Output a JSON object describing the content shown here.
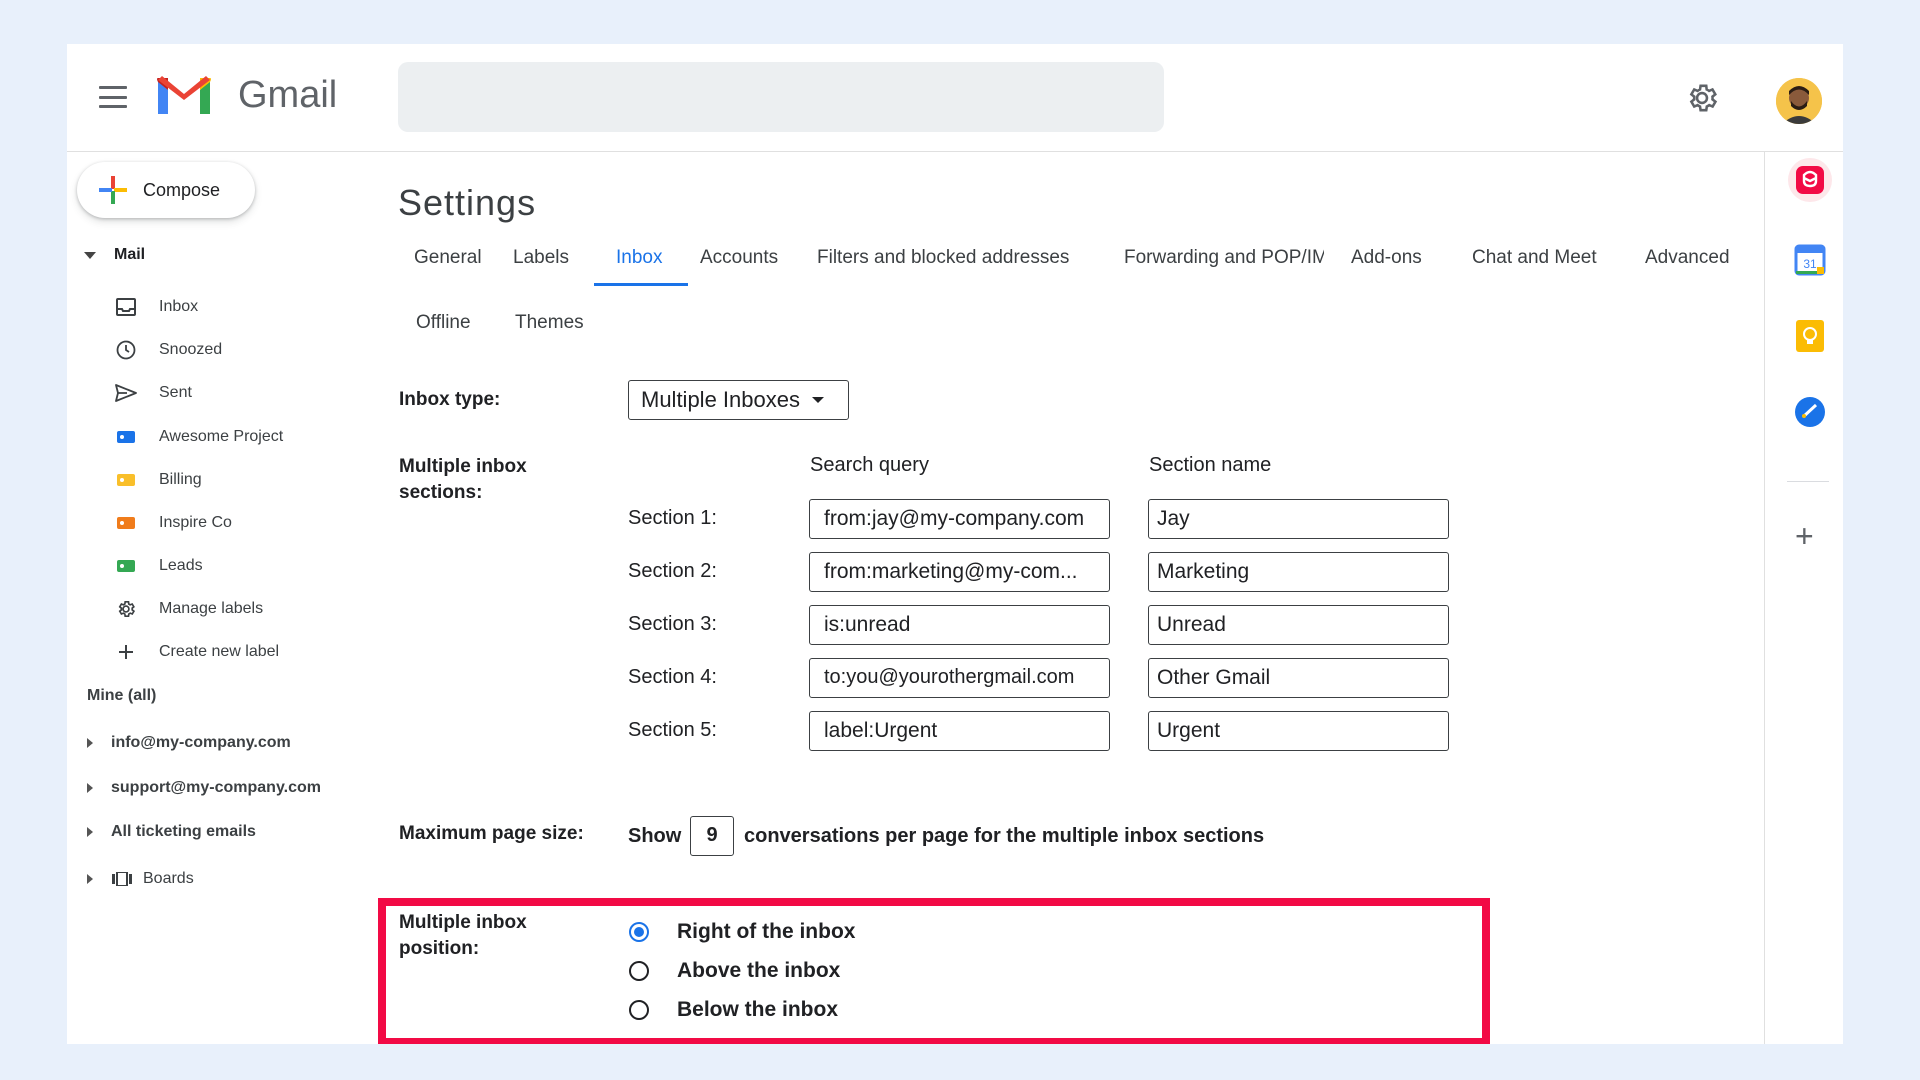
{
  "app": {
    "brand": "Gmail"
  },
  "search": {
    "placeholder": ""
  },
  "compose": {
    "label": "Compose"
  },
  "nav": {
    "section": "Mail",
    "items": [
      {
        "label": "Inbox",
        "icon": "inbox-icon"
      },
      {
        "label": "Snoozed",
        "icon": "clock-icon"
      },
      {
        "label": "Sent",
        "icon": "send-icon"
      },
      {
        "label": "Awesome Project",
        "icon": "label-icon",
        "color": "#1a73e8"
      },
      {
        "label": "Billing",
        "icon": "label-icon",
        "color": "#f9bf2a"
      },
      {
        "label": "Inspire Co",
        "icon": "label-icon",
        "color": "#f07c1b"
      },
      {
        "label": "Leads",
        "icon": "label-icon",
        "color": "#34a853"
      },
      {
        "label": "Manage labels",
        "icon": "gear-icon"
      },
      {
        "label": "Create new label",
        "icon": "plus-icon"
      }
    ],
    "mine": "Mine (all)",
    "accounts": [
      "info@my-company.com",
      "support@my-company.com",
      "All ticketing emails"
    ],
    "boards": "Boards"
  },
  "settings": {
    "title": "Settings",
    "tabs": [
      "General",
      "Labels",
      "Inbox",
      "Accounts",
      "Filters and blocked addresses",
      "Forwarding and POP/IMAP",
      "Add-ons",
      "Chat and Meet",
      "Advanced",
      "Offline",
      "Themes"
    ],
    "active_tab": "Inbox",
    "inbox_type_label": "Inbox type:",
    "inbox_type_value": "Multiple Inboxes",
    "sections_label": "Multiple inbox sections:",
    "col_query": "Search query",
    "col_name": "Section name",
    "sections": [
      {
        "label": "Section 1:",
        "query": "from:jay@my-company.com",
        "name": "Jay"
      },
      {
        "label": "Section 2:",
        "query": "from:marketing@my-com...",
        "name": "Marketing"
      },
      {
        "label": "Section 3:",
        "query": "is:unread",
        "name": "Unread"
      },
      {
        "label": "Section 4:",
        "query": "to:you@yourothergmail.com",
        "name": "Other Gmail"
      },
      {
        "label": "Section 5:",
        "query": "label:Urgent",
        "name": "Urgent"
      }
    ],
    "page_size_label": "Maximum page size:",
    "page_size_show": "Show",
    "page_size_value": "9",
    "page_size_suffix": "conversations per page for the multiple inbox sections",
    "position_label": "Multiple inbox position:",
    "positions": [
      "Right of the inbox",
      "Above the inbox",
      "Below the inbox"
    ],
    "selected_position": "Right of the inbox"
  },
  "side_apps": [
    "helpdesk-icon",
    "calendar-icon",
    "keep-icon",
    "tasks-icon",
    "add-icon"
  ],
  "calendar_day": "31",
  "colors": {
    "accent": "#1a73e8",
    "highlight": "#f20a45",
    "background": "#e8f0fb"
  }
}
